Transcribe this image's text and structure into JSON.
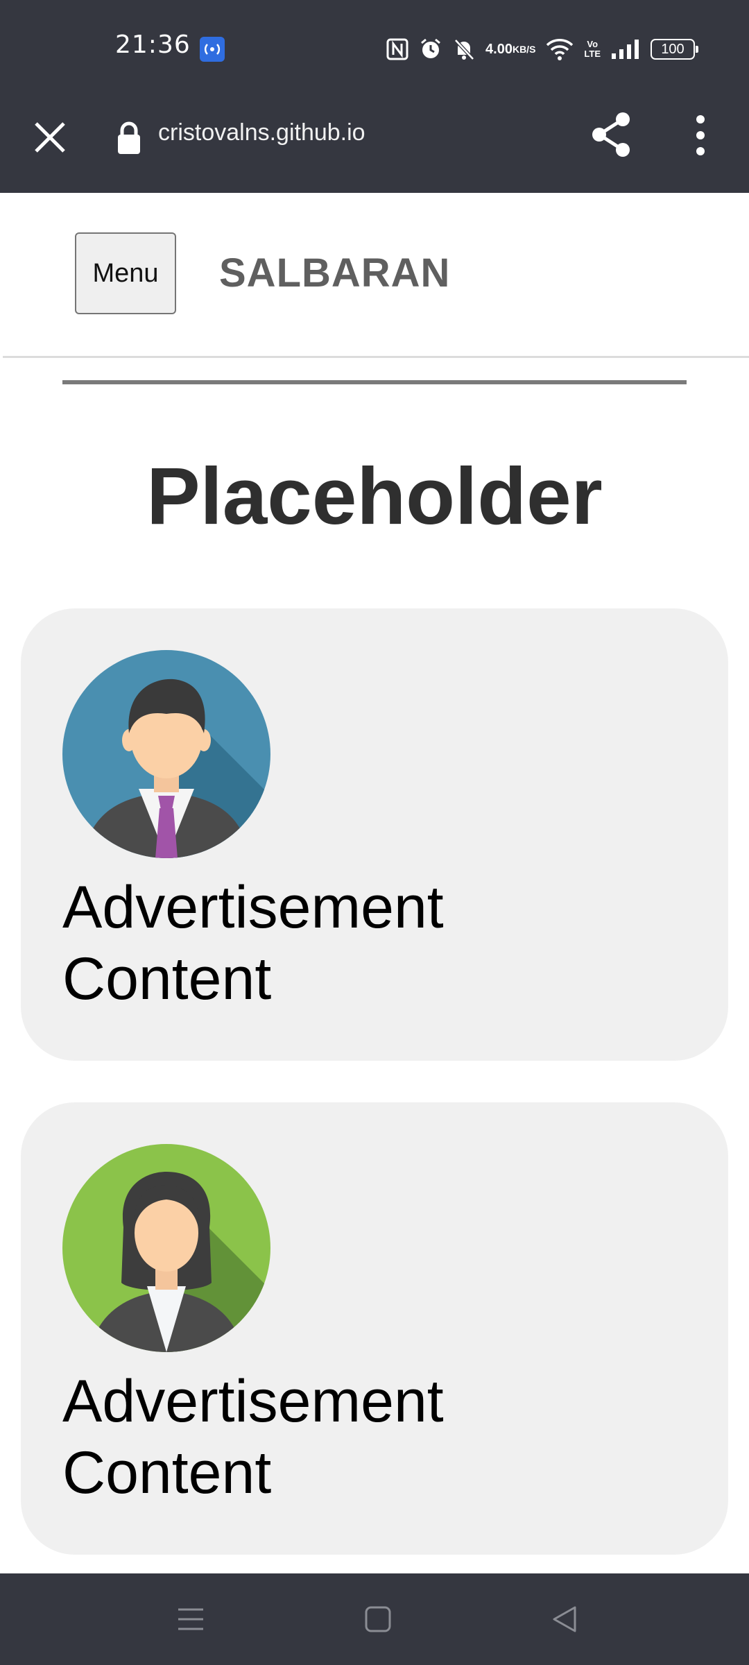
{
  "status_bar": {
    "time": "21:36",
    "speed_value": "4.00",
    "speed_unit": "KB/S",
    "volte_top": "Vo",
    "volte_bottom": "LTE",
    "battery": "100",
    "icons": [
      "nfc-app-icon",
      "nfc-icon",
      "alarm-icon",
      "mute-bell-icon",
      "wifi-icon",
      "signal-icon",
      "battery-icon"
    ]
  },
  "browser": {
    "url": "cristovalns.github.io",
    "icons": [
      "close-icon",
      "lock-icon",
      "share-icon",
      "more-vert-icon"
    ]
  },
  "header": {
    "menu_label": "Menu",
    "site_title": "SALBARAN"
  },
  "main": {
    "heading": "Placeholder",
    "cards": [
      {
        "text_line1": "Advertisement",
        "text_line2": "Content",
        "avatar": "male-avatar",
        "avatar_color": "#4a8fb0"
      },
      {
        "text_line1": "Advertisement",
        "text_line2": "Content",
        "avatar": "female-avatar",
        "avatar_color": "#8bc34a"
      }
    ]
  },
  "nav_bar": {
    "icons": [
      "recents-icon",
      "home-icon",
      "back-icon"
    ]
  },
  "colors": {
    "system_bar": "#353740",
    "card_bg": "#f0f0f0",
    "heading": "#2f2f2f",
    "site_title": "#5f5f5f"
  }
}
